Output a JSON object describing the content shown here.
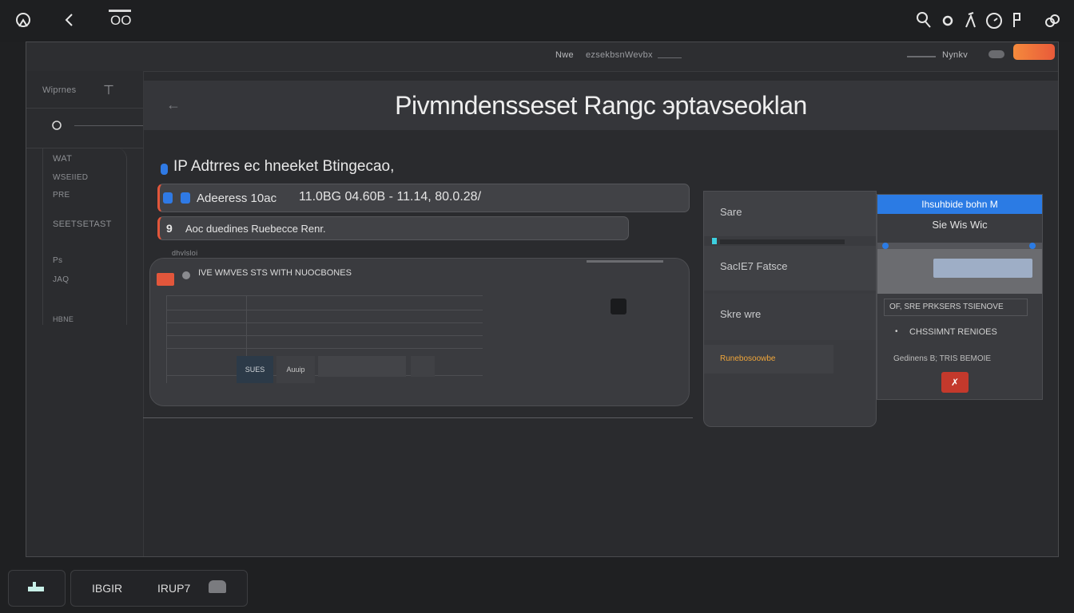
{
  "topbar": {
    "left_icons": [
      "home-icon",
      "back-icon"
    ],
    "left_label": "OO",
    "right_icons": [
      "search-icon",
      "circle-icon",
      "lambda-icon",
      "clock-icon",
      "pin-icon",
      "link-icon"
    ]
  },
  "window": {
    "header_left": "Nwe",
    "header_center": "ezsekbsnWevbx",
    "header_right": "Nynkv",
    "accent": "#f06c3a"
  },
  "sidebar": {
    "header_label": "Wiprnes",
    "items": [
      "WAT",
      "WSEIIED",
      "PRE",
      "SEETSETAST",
      "Ps",
      "JAQ",
      "HBNE"
    ]
  },
  "main": {
    "title": "Pivmndensseset Rangc эptavseoklan",
    "subtitle": "IP Adtrres ec hneeket Btingecao,",
    "address_label": "Adeeress 10ac",
    "address_value": "11.0BG 04.60B - 11.14, 80.0.28/",
    "range_label": "Aoc duedines Ruebecce Renr.",
    "card_header": "dhvlsloi",
    "card_title": "IVE WMVES STS  WITH NUOCBONES",
    "table_buttons": [
      "SUES",
      "Auuip"
    ]
  },
  "middle_col": {
    "items": [
      "Sare",
      "SacIE7 Fatsce",
      "Skre wre",
      "Runebosoowbe"
    ]
  },
  "right_col": {
    "header": "Ihsuhbide  bohn M",
    "sub": "Sie Wis Wic",
    "labels": [
      "OF, SRE PRKSERS TSIENOVE",
      "CHSSIMNT RENIOES",
      "Gedinens  B;  TRIS BEMOIE"
    ]
  },
  "footer": {
    "items": [
      "IBGIR",
      "IRUP7"
    ]
  },
  "colors": {
    "accent_red": "#e2563b",
    "accent_blue": "#2b7be4",
    "accent_orange": "#f06c3a"
  }
}
